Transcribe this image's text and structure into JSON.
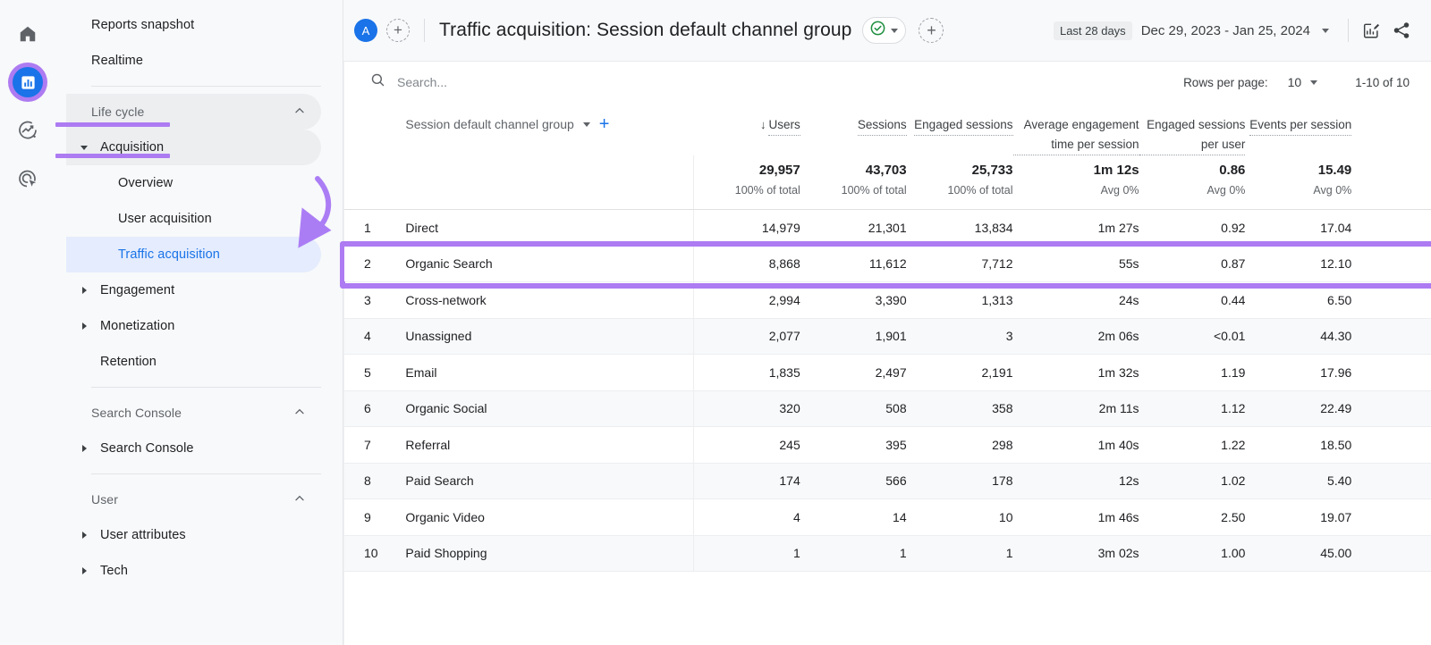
{
  "rail": {
    "items": [
      {
        "name": "home-icon",
        "label": "Home"
      },
      {
        "name": "reports-icon",
        "label": "Reports"
      },
      {
        "name": "explore-icon",
        "label": "Explore"
      },
      {
        "name": "advertising-icon",
        "label": "Advertising"
      }
    ]
  },
  "sidebar": {
    "top_items": [
      {
        "label": "Reports snapshot"
      },
      {
        "label": "Realtime"
      }
    ],
    "sections": [
      {
        "title": "Life cycle",
        "collapse_icon": "chevron-up-icon",
        "items": [
          {
            "label": "Acquisition",
            "level": 1,
            "expanded": true,
            "marked": true
          },
          {
            "label": "Overview",
            "level": 2
          },
          {
            "label": "User acquisition",
            "level": 2
          },
          {
            "label": "Traffic acquisition",
            "level": 2,
            "selected": true
          },
          {
            "label": "Engagement",
            "level": 1
          },
          {
            "label": "Monetization",
            "level": 1
          },
          {
            "label": "Retention",
            "level": 1,
            "no_caret": true
          }
        ]
      },
      {
        "title": "Search Console",
        "collapse_icon": "chevron-up-icon",
        "items": [
          {
            "label": "Search Console",
            "level": 1
          }
        ]
      },
      {
        "title": "User",
        "collapse_icon": "chevron-up-icon",
        "items": [
          {
            "label": "User attributes",
            "level": 1
          },
          {
            "label": "Tech",
            "level": 1
          }
        ]
      }
    ]
  },
  "header": {
    "avatar_letter": "A",
    "add_comparison_label": "+",
    "title": "Traffic acquisition: Session default channel group",
    "compare_badge_icon": "check-circle-icon",
    "add_compare_icon": "plus-circle-dashed-icon",
    "date_chip": "Last 28 days",
    "date_range": "Dec 29, 2023 - Jan 25, 2024",
    "edit_icon": "edit-chart-icon",
    "share_icon": "share-icon"
  },
  "toolbar": {
    "search_placeholder": "Search...",
    "search_value": "",
    "search_icon": "search-icon",
    "rows_per_page_label": "Rows per page:",
    "rows_per_page_value": "10",
    "pagination": "1-10 of 10"
  },
  "table": {
    "dimension_header": "Session default channel group",
    "dimension_add_icon": "plus-icon",
    "sort_indicator": "↓",
    "columns": [
      {
        "label": "Users",
        "sorted": true
      },
      {
        "label": "Sessions"
      },
      {
        "label": "Engaged sessions"
      },
      {
        "label": "Average engagement time per session"
      },
      {
        "label": "Engaged sessions per user"
      },
      {
        "label": "Events per session"
      }
    ],
    "totals": [
      {
        "value": "29,957",
        "sub": "100% of total"
      },
      {
        "value": "43,703",
        "sub": "100% of total"
      },
      {
        "value": "25,733",
        "sub": "100% of total"
      },
      {
        "value": "1m 12s",
        "sub": "Avg 0%"
      },
      {
        "value": "0.86",
        "sub": "Avg 0%"
      },
      {
        "value": "15.49",
        "sub": "Avg 0%"
      }
    ],
    "rows": [
      {
        "index": "1",
        "dimension": "Direct",
        "values": [
          "14,979",
          "21,301",
          "13,834",
          "1m 27s",
          "0.92",
          "17.04"
        ]
      },
      {
        "index": "2",
        "dimension": "Organic Search",
        "values": [
          "8,868",
          "11,612",
          "7,712",
          "55s",
          "0.87",
          "12.10"
        ],
        "highlighted": true
      },
      {
        "index": "3",
        "dimension": "Cross-network",
        "values": [
          "2,994",
          "3,390",
          "1,313",
          "24s",
          "0.44",
          "6.50"
        ]
      },
      {
        "index": "4",
        "dimension": "Unassigned",
        "values": [
          "2,077",
          "1,901",
          "3",
          "2m 06s",
          "<0.01",
          "44.30"
        ]
      },
      {
        "index": "5",
        "dimension": "Email",
        "values": [
          "1,835",
          "2,497",
          "2,191",
          "1m 32s",
          "1.19",
          "17.96"
        ]
      },
      {
        "index": "6",
        "dimension": "Organic Social",
        "values": [
          "320",
          "508",
          "358",
          "2m 11s",
          "1.12",
          "22.49"
        ]
      },
      {
        "index": "7",
        "dimension": "Referral",
        "values": [
          "245",
          "395",
          "298",
          "1m 40s",
          "1.22",
          "18.50"
        ]
      },
      {
        "index": "8",
        "dimension": "Paid Search",
        "values": [
          "174",
          "566",
          "178",
          "12s",
          "1.02",
          "5.40"
        ]
      },
      {
        "index": "9",
        "dimension": "Organic Video",
        "values": [
          "4",
          "14",
          "10",
          "1m 46s",
          "2.50",
          "19.07"
        ]
      },
      {
        "index": "10",
        "dimension": "Paid Shopping",
        "values": [
          "1",
          "1",
          "1",
          "3m 02s",
          "1.00",
          "45.00"
        ]
      }
    ]
  },
  "annotations": {
    "highlight_color": "#ad7bf2",
    "arrow_icon": "curved-arrow-annotation",
    "accent_blue": "#1a73e8"
  }
}
